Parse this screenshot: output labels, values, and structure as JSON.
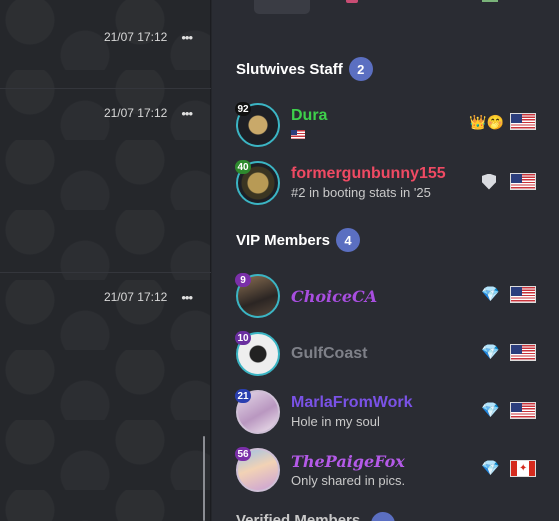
{
  "chat": {
    "messages": [
      {
        "time": "21/07 17:12",
        "menu": "•••"
      },
      {
        "time": "21/07 17:12",
        "menu": "•••"
      },
      {
        "time": "21/07 17:12",
        "menu": "•••"
      }
    ]
  },
  "panel": {
    "staff": {
      "title": "Slutwives Staff",
      "count": "2",
      "members": [
        {
          "name": "Dura",
          "level": "92",
          "status": "",
          "name_color": "#3ecf4b",
          "badges": [
            "crown-emoji-icon",
            "us-flag-icon"
          ]
        },
        {
          "name": "formergunbunny155",
          "level": "40",
          "status": "#2 in booting stats in '25",
          "name_color": "#ef4a63",
          "badges": [
            "shield-icon",
            "us-flag-icon"
          ]
        }
      ]
    },
    "vip": {
      "title": "VIP Members",
      "count": "4",
      "members": [
        {
          "name": "ChoiceCA",
          "level": "9",
          "status": "",
          "name_color": "#a84ee0",
          "badges": [
            "diamond-icon",
            "us-flag-icon"
          ]
        },
        {
          "name": "GulfCoast",
          "level": "10",
          "status": "",
          "name_color": "#7e8088",
          "badges": [
            "diamond-icon",
            "us-flag-icon"
          ]
        },
        {
          "name": "MarlaFromWork",
          "level": "21",
          "status": "Hole in my soul",
          "name_color": "#7a52e6",
          "badges": [
            "diamond-icon",
            "us-flag-icon"
          ]
        },
        {
          "name": "ThePaigeFox",
          "level": "56",
          "status": "Only shared in pics.",
          "name_color": "#b45ae8",
          "badges": [
            "diamond-icon",
            "ca-flag-icon"
          ]
        }
      ]
    },
    "next_section": {
      "title": "Verified Members"
    }
  }
}
